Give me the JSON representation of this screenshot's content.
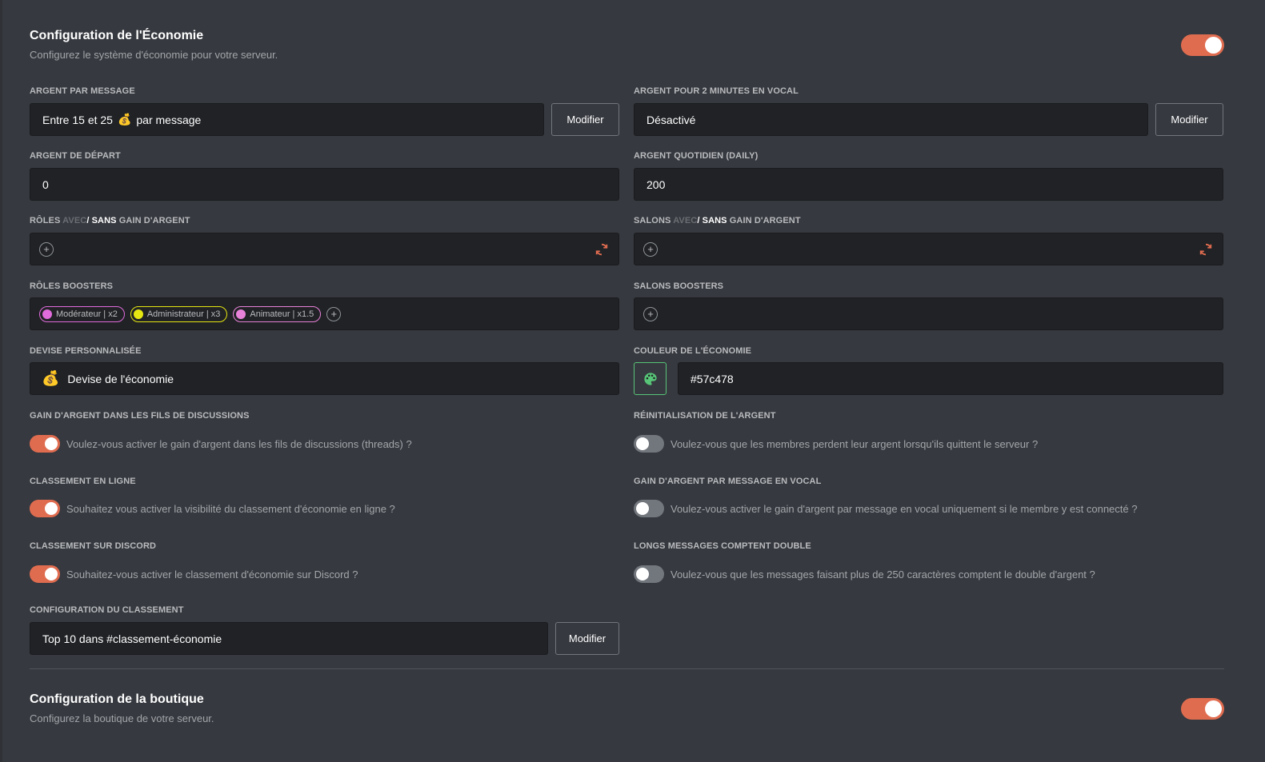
{
  "economy": {
    "title": "Configuration de l'Économie",
    "description": "Configurez le système d'économie pour votre serveur.",
    "enabled": true
  },
  "money_per_message": {
    "label": "ARGENT PAR MESSAGE",
    "value_prefix": "Entre 15 et 25",
    "value_suffix": "par message",
    "button": "Modifier"
  },
  "money_vocal": {
    "label": "ARGENT POUR 2 MINUTES EN VOCAL",
    "value": "Désactivé",
    "button": "Modifier"
  },
  "start_money": {
    "label": "ARGENT DE DÉPART",
    "value": "0"
  },
  "daily_money": {
    "label": "ARGENT QUOTIDIEN (DAILY)",
    "value": "200"
  },
  "roles_gain": {
    "label_start": "RÔLES",
    "label_avec": "AVEC",
    "label_sep": "/",
    "label_sans": "SANS",
    "label_end": "GAIN D'ARGENT"
  },
  "channels_gain": {
    "label_start": "SALONS",
    "label_avec": "AVEC",
    "label_sep": "/",
    "label_sans": "SANS",
    "label_end": "GAIN D'ARGENT"
  },
  "roles_boosters": {
    "label": "RÔLES BOOSTERS",
    "chips": [
      {
        "text": "Modérateur | x2",
        "color": "#e06bdc"
      },
      {
        "text": "Administrateur | x3",
        "color": "#e6e612"
      },
      {
        "text": "Animateur | x1.5",
        "color": "#e882d9"
      }
    ]
  },
  "channels_boosters": {
    "label": "SALONS BOOSTERS"
  },
  "currency": {
    "label": "DEVISE PERSONNALISÉE",
    "value": "Devise de l'économie"
  },
  "economy_color": {
    "label": "COULEUR DE L'ÉCONOMIE",
    "value": "#57c478"
  },
  "threads": {
    "label": "GAIN D'ARGENT DANS LES FILS DE DISCUSSIONS",
    "text": "Voulez-vous activer le gain d'argent dans les fils de discussions (threads) ?",
    "enabled": true
  },
  "reset": {
    "label": "RÉINITIALISATION DE L'ARGENT",
    "text": "Voulez-vous que les membres perdent leur argent lorsqu'ils quittent le serveur ?",
    "enabled": false
  },
  "online_ranking": {
    "label": "CLASSEMENT EN LIGNE",
    "text": "Souhaitez vous activer la visibilité du classement d'économie en ligne ?",
    "enabled": true
  },
  "vocal_message": {
    "label": "GAIN D'ARGENT PAR MESSAGE EN VOCAL",
    "text": "Voulez-vous activer le gain d'argent par message en vocal uniquement si le membre y est connecté ?",
    "enabled": false
  },
  "discord_ranking": {
    "label": "CLASSEMENT SUR DISCORD",
    "text": "Souhaitez-vous activer le classement d'économie sur Discord ?",
    "enabled": true
  },
  "long_messages": {
    "label": "LONGS MESSAGES COMPTENT DOUBLE",
    "text": "Voulez-vous que les messages faisant plus de 250 caractères comptent le double d'argent ?",
    "enabled": false
  },
  "ranking_config": {
    "label": "CONFIGURATION DU CLASSEMENT",
    "value": "Top 10 dans #classement-économie",
    "button": "Modifier"
  },
  "shop": {
    "title": "Configuration de la boutique",
    "description": "Configurez la boutique de votre serveur.",
    "enabled": true
  },
  "icons": {
    "money_bag": "money-bag-icon",
    "palette": "palette-icon",
    "refresh": "refresh-icon",
    "plus": "plus-icon"
  },
  "colors": {
    "accent": "#e06c50",
    "economy": "#57c478"
  }
}
